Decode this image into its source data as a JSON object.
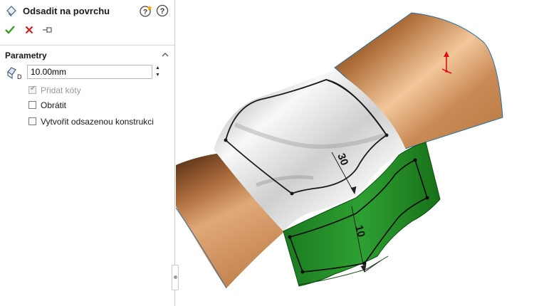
{
  "property_manager": {
    "title": "Odsadit na povrchu",
    "group": {
      "title": "Parametry",
      "distance_value": "10.00mm",
      "options": [
        {
          "label": "Přidat kóty",
          "checked": true,
          "enabled": false
        },
        {
          "label": "Obrátit",
          "checked": false,
          "enabled": true
        },
        {
          "label": "Vytvořit odsazenou konstrukci",
          "checked": false,
          "enabled": true
        }
      ]
    }
  },
  "viewport": {
    "dimensions": [
      "30",
      "10"
    ]
  },
  "colors": {
    "copper": "#c98a55",
    "chrome": "#d8d8d8",
    "offset_surface": "#1f8a23",
    "ok_green": "#3a9a2a",
    "cancel_red": "#d02020",
    "triad_red": "#e01010"
  }
}
